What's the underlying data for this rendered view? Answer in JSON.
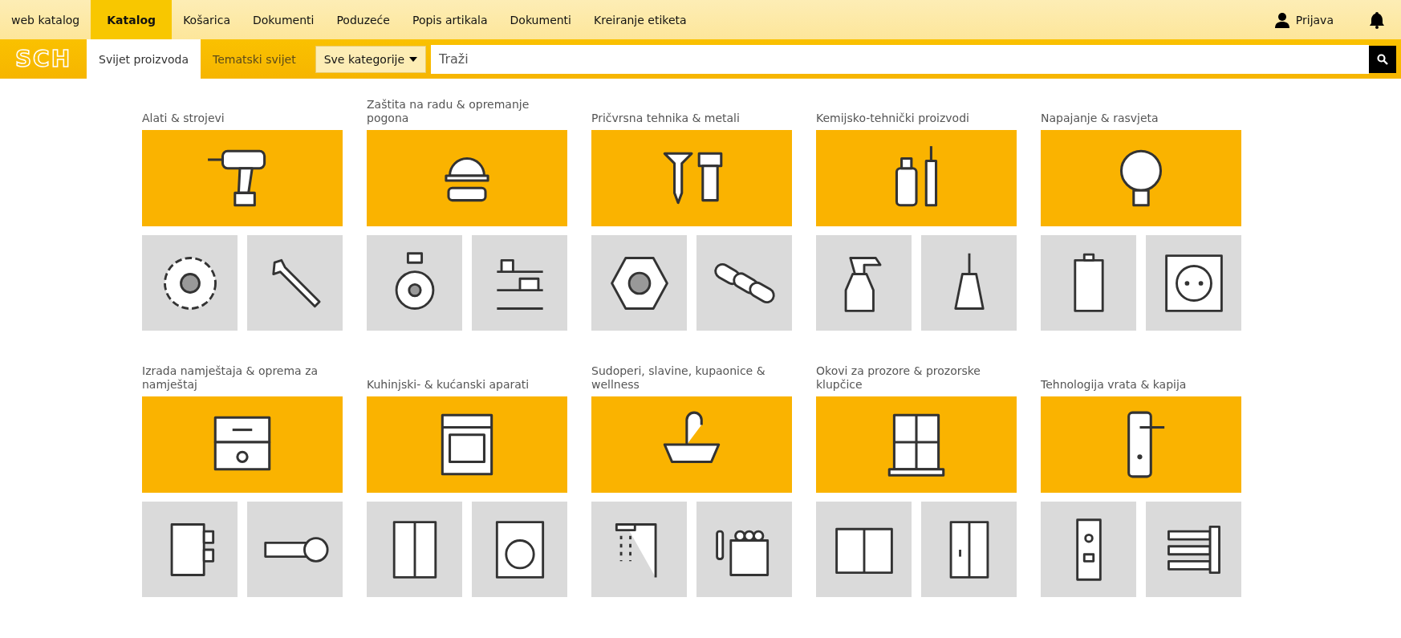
{
  "top_nav": [
    {
      "label": "web katalog",
      "selected": false
    },
    {
      "label": "Katalog",
      "selected": true
    },
    {
      "label": "Košarica",
      "selected": false
    },
    {
      "label": "Dokumenti",
      "selected": false
    },
    {
      "label": "Poduzeće",
      "selected": false
    },
    {
      "label": "Popis artikala",
      "selected": false
    },
    {
      "label": "Dokumenti",
      "selected": false
    },
    {
      "label": "Kreiranje etiketa",
      "selected": false
    }
  ],
  "login": {
    "label": "Prijava"
  },
  "logo": {
    "text": "SCH"
  },
  "sub_tabs": [
    {
      "label": "Svijet proizvoda",
      "selected": true
    },
    {
      "label": "Tematski svijet",
      "selected": false
    }
  ],
  "category_select": {
    "value": "Sve kategorije"
  },
  "search": {
    "placeholder": "Traži"
  },
  "categories": [
    {
      "title": "Alati & strojevi"
    },
    {
      "title": "Zaštita na radu & opremanje pogona"
    },
    {
      "title": "Pričvrsna tehnika & metali"
    },
    {
      "title": "Kemijsko-tehnički proizvodi"
    },
    {
      "title": "Napajanje & rasvjeta"
    },
    {
      "title": "Izrada namještaja & oprema za namještaj"
    },
    {
      "title": "Kuhinjski- & kućanski aparati"
    },
    {
      "title": "Sudoperi, slavine, kupaonice & wellness"
    },
    {
      "title": "Okovi za prozore & prozorske klupčice"
    },
    {
      "title": "Tehnologija vrata & kapija"
    }
  ]
}
